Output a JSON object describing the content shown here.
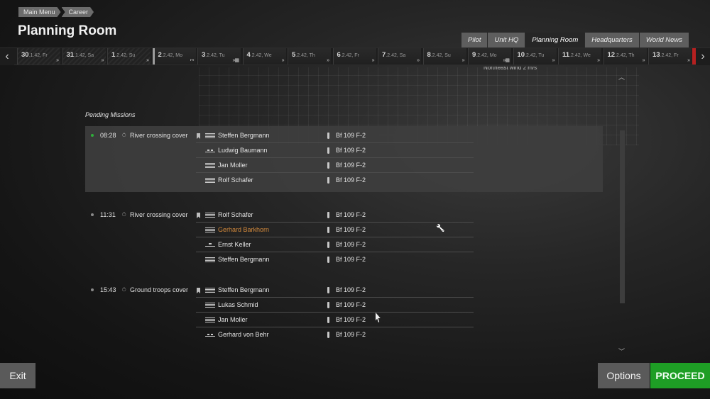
{
  "breadcrumb": [
    "Main Menu",
    "Career"
  ],
  "page_title": "Planning Room",
  "tabs": [
    {
      "label": "Pilot",
      "active": false
    },
    {
      "label": "Unit HQ",
      "active": false
    },
    {
      "label": "Planning Room",
      "active": true
    },
    {
      "label": "Headquarters",
      "active": false
    },
    {
      "label": "World News",
      "active": false
    }
  ],
  "timeline": {
    "prev_icon": "chevron-left-icon",
    "next_icon": "chevron-right-icon",
    "days": [
      {
        "num": "30",
        "date": ".1.42, Fr",
        "marker": "»"
      },
      {
        "num": "31",
        "date": ".1.42, Sa",
        "marker": "»"
      },
      {
        "num": "1",
        "date": ".2.42, Su",
        "marker": "»"
      },
      {
        "num": "2",
        "date": ".2.42, Mo",
        "marker": "↦"
      },
      {
        "num": "3",
        "date": ".2.42, Tu",
        "marker": "»▦"
      },
      {
        "num": "4",
        "date": ".2.42, We",
        "marker": "»"
      },
      {
        "num": "5",
        "date": ".2.42, Th",
        "marker": "»"
      },
      {
        "num": "6",
        "date": ".2.42, Fr",
        "marker": "»"
      },
      {
        "num": "7",
        "date": ".2.42, Sa",
        "marker": "»"
      },
      {
        "num": "8",
        "date": ".2.42, Su",
        "marker": "»"
      },
      {
        "num": "9",
        "date": ".2.42, Mo",
        "marker": "»▦"
      },
      {
        "num": "10",
        "date": ".2.42, Tu",
        "marker": "»"
      },
      {
        "num": "11",
        "date": ".2.42, We",
        "marker": "»"
      },
      {
        "num": "12",
        "date": ".2.42, Th",
        "marker": "»"
      },
      {
        "num": "13",
        "date": ".2.42, Fr",
        "marker": "»"
      }
    ]
  },
  "weather_text": "Northeast wind 2 m/s",
  "section_title": "Pending Missions",
  "missions": [
    {
      "time": "08:28",
      "name": "River crossing cover",
      "status_color": "#2fae3a",
      "selected": true,
      "pilots": [
        {
          "name": "Steffen Bergmann",
          "plane": "Bf 109 F-2"
        },
        {
          "name": "Ludwig Baumann",
          "plane": "Bf 109 F-2"
        },
        {
          "name": "Jan Moller",
          "plane": "Bf 109 F-2"
        },
        {
          "name": "Rolf Schafer",
          "plane": "Bf 109 F-2"
        }
      ]
    },
    {
      "time": "11:31",
      "name": "River crossing cover",
      "status_color": "#8a8a8a",
      "selected": false,
      "pilots": [
        {
          "name": "Rolf Schafer",
          "plane": "Bf 109 F-2"
        },
        {
          "name": "Gerhard Barkhorn",
          "plane": "Bf 109 F-2",
          "highlight": true
        },
        {
          "name": "Ernst Keller",
          "plane": "Bf 109 F-2"
        },
        {
          "name": "Steffen Bergmann",
          "plane": "Bf 109 F-2"
        }
      ]
    },
    {
      "time": "15:43",
      "name": "Ground troops cover",
      "status_color": "#8a8a8a",
      "selected": false,
      "pilots": [
        {
          "name": "Steffen Bergmann",
          "plane": "Bf 109 F-2"
        },
        {
          "name": "Lukas Schmid",
          "plane": "Bf 109 F-2"
        },
        {
          "name": "Jan Moller",
          "plane": "Bf 109 F-2"
        },
        {
          "name": "Gerhard von Behr",
          "plane": "Bf 109 F-2"
        }
      ]
    }
  ],
  "buttons": {
    "exit": "Exit",
    "options": "Options",
    "proceed": "PROCEED"
  },
  "colors": {
    "proceed": "#1e9e25",
    "highlight_pilot": "#d48a3c"
  }
}
